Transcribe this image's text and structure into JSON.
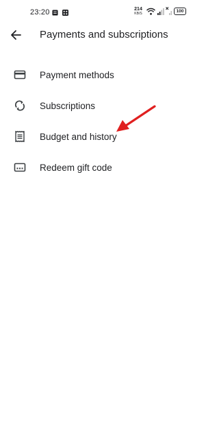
{
  "status_bar": {
    "time": "23:20",
    "net_speed_value": "214",
    "net_speed_unit": "KB/S",
    "battery": "100",
    "icons": [
      "notification-icon",
      "grid-app-icon",
      "wifi-icon",
      "signal-icon",
      "signal-x-icon",
      "battery-icon"
    ]
  },
  "app_bar": {
    "back_icon": "arrow-back-icon",
    "title": "Payments and subscriptions"
  },
  "menu": {
    "items": [
      {
        "label": "Payment methods",
        "icon": "credit-card-icon"
      },
      {
        "label": "Subscriptions",
        "icon": "refresh-icon"
      },
      {
        "label": "Budget and history",
        "icon": "receipt-icon"
      },
      {
        "label": "Redeem gift code",
        "icon": "gift-code-icon"
      }
    ]
  },
  "annotation": {
    "arrow_color": "#e02020"
  },
  "colors": {
    "text": "#202124",
    "icon": "#3c4043",
    "background": "#ffffff"
  }
}
